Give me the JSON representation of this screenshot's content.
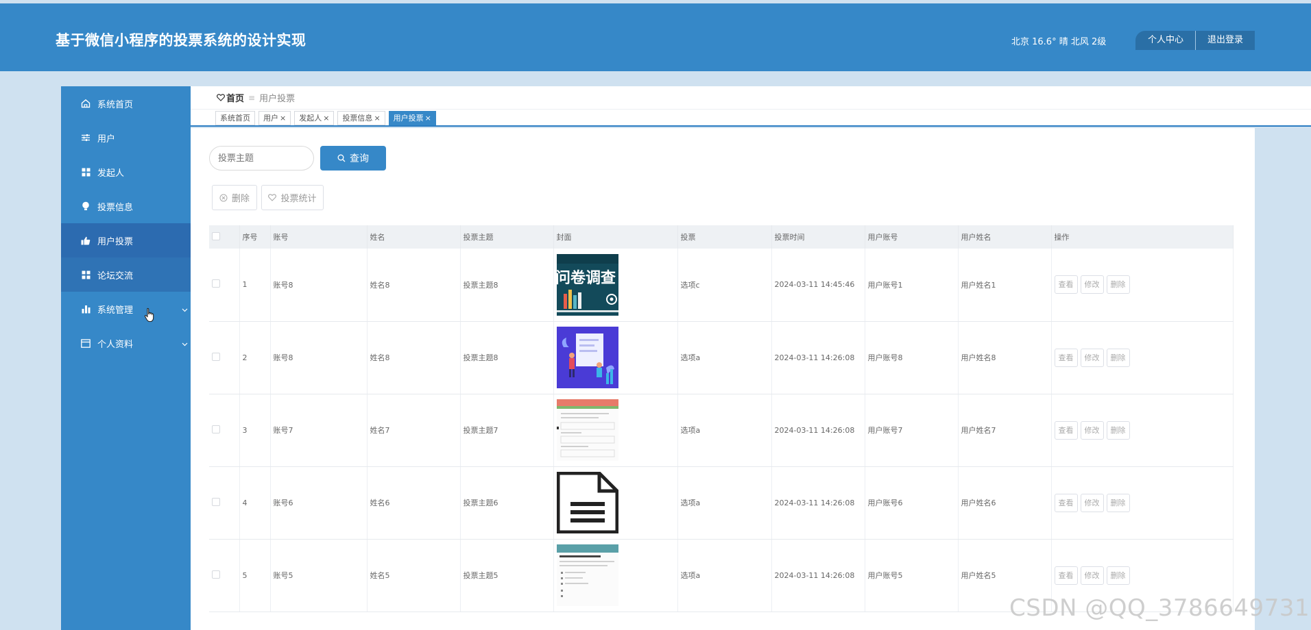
{
  "app": {
    "title": "基于微信小程序的投票系统的设计实现"
  },
  "header": {
    "weather": "北京  16.6°  晴  北风  2级",
    "personal_center": "个人中心",
    "logout": "退出登录"
  },
  "sidebar": {
    "items": [
      {
        "label": "系统首页",
        "icon": "home-icon"
      },
      {
        "label": "用户",
        "icon": "sliders-icon"
      },
      {
        "label": "发起人",
        "icon": "grid-icon"
      },
      {
        "label": "投票信息",
        "icon": "bulb-icon"
      },
      {
        "label": "用户投票",
        "icon": "thumbs-up-icon"
      },
      {
        "label": "论坛交流",
        "icon": "grid-icon"
      },
      {
        "label": "系统管理",
        "icon": "bar-chart-icon"
      },
      {
        "label": "个人资料",
        "icon": "calendar-icon"
      }
    ]
  },
  "breadcrumb": {
    "home": "首页",
    "divider": "≡",
    "current": "用户投票"
  },
  "tags": [
    {
      "label": "系统首页",
      "closable": false
    },
    {
      "label": "用户",
      "closable": true
    },
    {
      "label": "发起人",
      "closable": true
    },
    {
      "label": "投票信息",
      "closable": true
    },
    {
      "label": "用户投票",
      "closable": true
    }
  ],
  "search": {
    "placeholder": "投票主题",
    "button": "查询"
  },
  "actions": {
    "delete": "删除",
    "stats": "投票统计"
  },
  "table": {
    "columns": [
      "序号",
      "账号",
      "姓名",
      "投票主题",
      "封面",
      "投票",
      "投票时间",
      "用户账号",
      "用户姓名",
      "操作"
    ],
    "row_actions": {
      "view": "查看",
      "edit": "修改",
      "delete": "删除"
    },
    "rows": [
      {
        "no": "1",
        "account": "账号8",
        "name": "姓名8",
        "topic": "投票主题8",
        "cover_text": "问卷调查",
        "vote": "选项c",
        "time": "2024-03-11 14:45:46",
        "user_account": "用户账号1",
        "user_name": "用户姓名1"
      },
      {
        "no": "2",
        "account": "账号8",
        "name": "姓名8",
        "topic": "投票主题8",
        "vote": "选项a",
        "time": "2024-03-11 14:26:08",
        "user_account": "用户账号8",
        "user_name": "用户姓名8"
      },
      {
        "no": "3",
        "account": "账号7",
        "name": "姓名7",
        "topic": "投票主题7",
        "vote": "选项a",
        "time": "2024-03-11 14:26:08",
        "user_account": "用户账号7",
        "user_name": "用户姓名7"
      },
      {
        "no": "4",
        "account": "账号6",
        "name": "姓名6",
        "topic": "投票主题6",
        "vote": "选项a",
        "time": "2024-03-11 14:26:08",
        "user_account": "用户账号6",
        "user_name": "用户姓名6"
      },
      {
        "no": "5",
        "account": "账号5",
        "name": "姓名5",
        "topic": "投票主题5",
        "vote": "选项a",
        "time": "2024-03-11 14:26:08",
        "user_account": "用户账号5",
        "user_name": "用户姓名5"
      }
    ]
  },
  "watermark": "CSDN @QQ_3786649731"
}
